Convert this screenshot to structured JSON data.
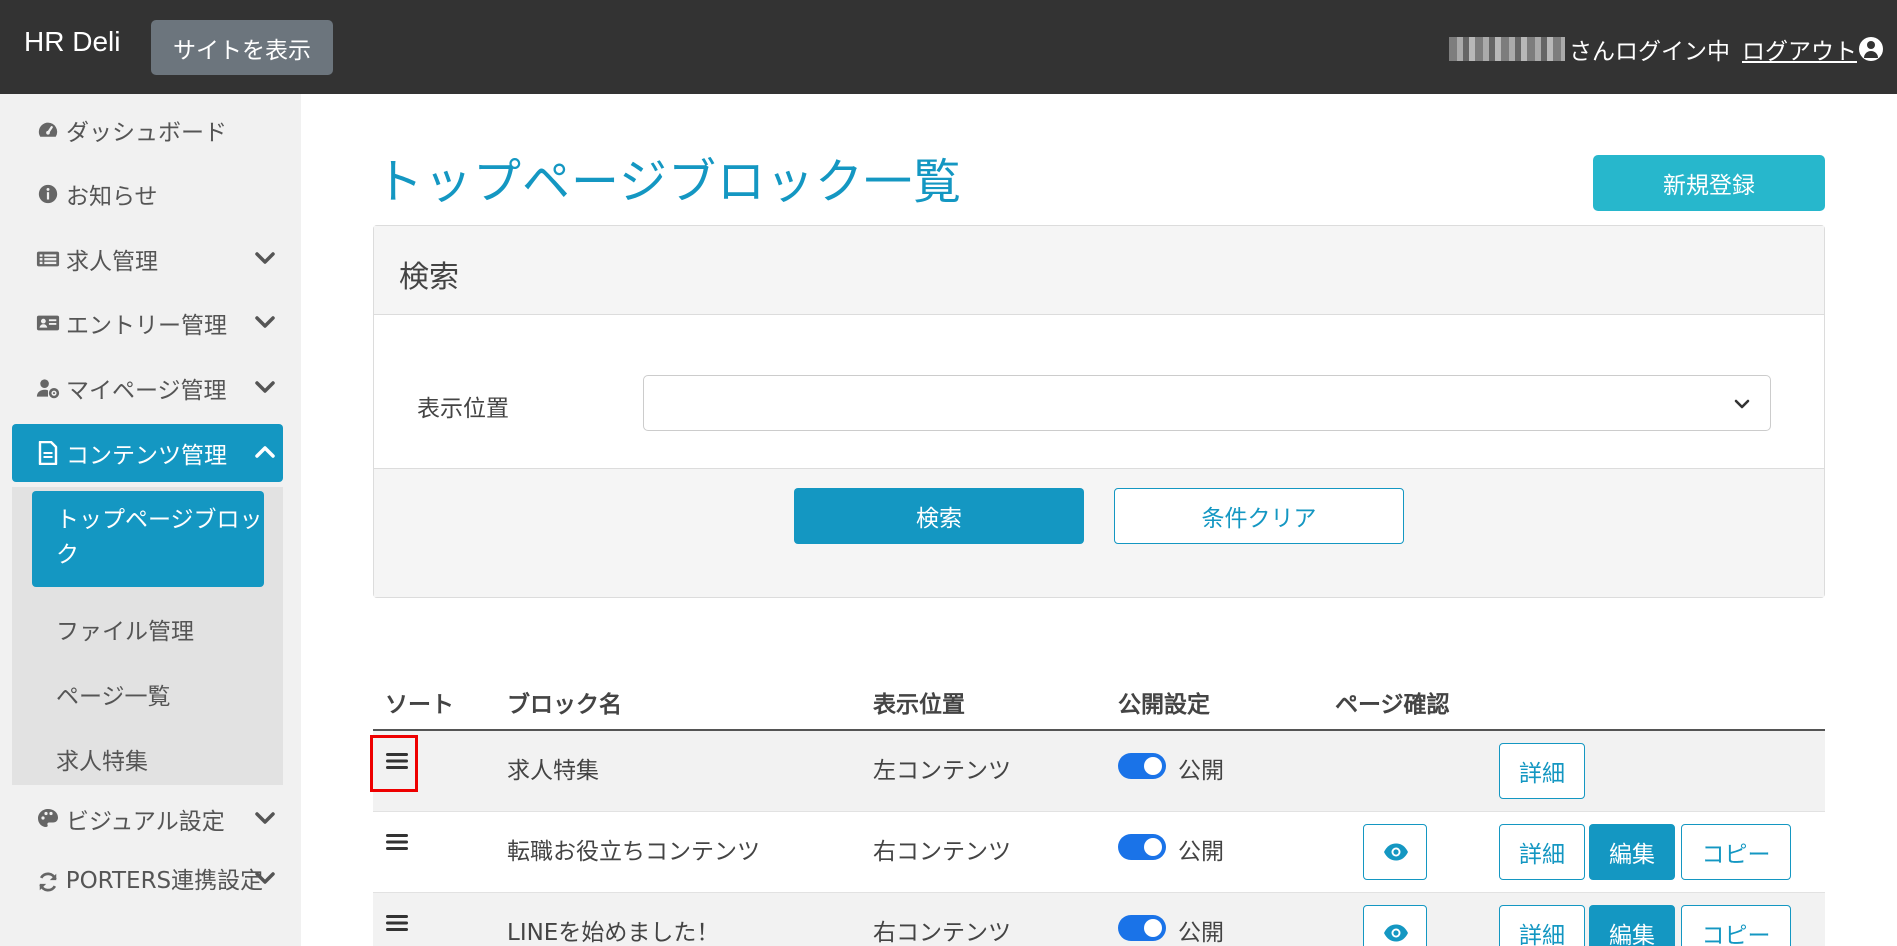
{
  "header": {
    "brand": "HR Deli",
    "site_button": "サイトを表示",
    "login_status": "さんログイン中",
    "logout": "ログアウト"
  },
  "sidebar": {
    "items": [
      {
        "label": "ダッシュボード",
        "icon": "tachometer-icon"
      },
      {
        "label": "お知らせ",
        "icon": "info-circle-icon"
      },
      {
        "label": "求人管理",
        "icon": "list-icon"
      },
      {
        "label": "エントリー管理",
        "icon": "id-card-icon"
      },
      {
        "label": "マイページ管理",
        "icon": "user-cog-icon"
      },
      {
        "label": "コンテンツ管理",
        "icon": "file-icon"
      },
      {
        "label": "ビジュアル設定",
        "icon": "palette-icon"
      },
      {
        "label": "PORTERS連携設定",
        "icon": "sync-icon"
      }
    ],
    "submenu": [
      {
        "label": "トップページブロック"
      },
      {
        "label": "ファイル管理"
      },
      {
        "label": "ページ一覧"
      },
      {
        "label": "求人特集"
      }
    ]
  },
  "main": {
    "title": "トップページブロック一覧",
    "new_button": "新規登録",
    "search": {
      "title": "検索",
      "field_label": "表示位置",
      "select_value": "",
      "search_button": "検索",
      "clear_button": "条件クリア"
    },
    "table": {
      "headers": [
        "ソート",
        "ブロック名",
        "表示位置",
        "公開設定",
        "ページ確認"
      ],
      "rows": [
        {
          "name": "求人特集",
          "position": "左コンテンツ",
          "public": "公開",
          "detail": "詳細"
        },
        {
          "name": "転職お役立ちコンテンツ",
          "position": "右コンテンツ",
          "public": "公開",
          "detail": "詳細",
          "edit": "編集",
          "copy": "コピー"
        },
        {
          "name": "LINEを始めました！",
          "position": "右コンテンツ",
          "public": "公開",
          "detail": "詳細",
          "edit": "編集",
          "copy": "コピー"
        }
      ]
    }
  },
  "colors": {
    "header_bg": "#333333",
    "primary": "#1497c2",
    "new_button": "#27b7cc",
    "toggle_on": "#1a73e8",
    "highlight_box": "#ee0000"
  }
}
